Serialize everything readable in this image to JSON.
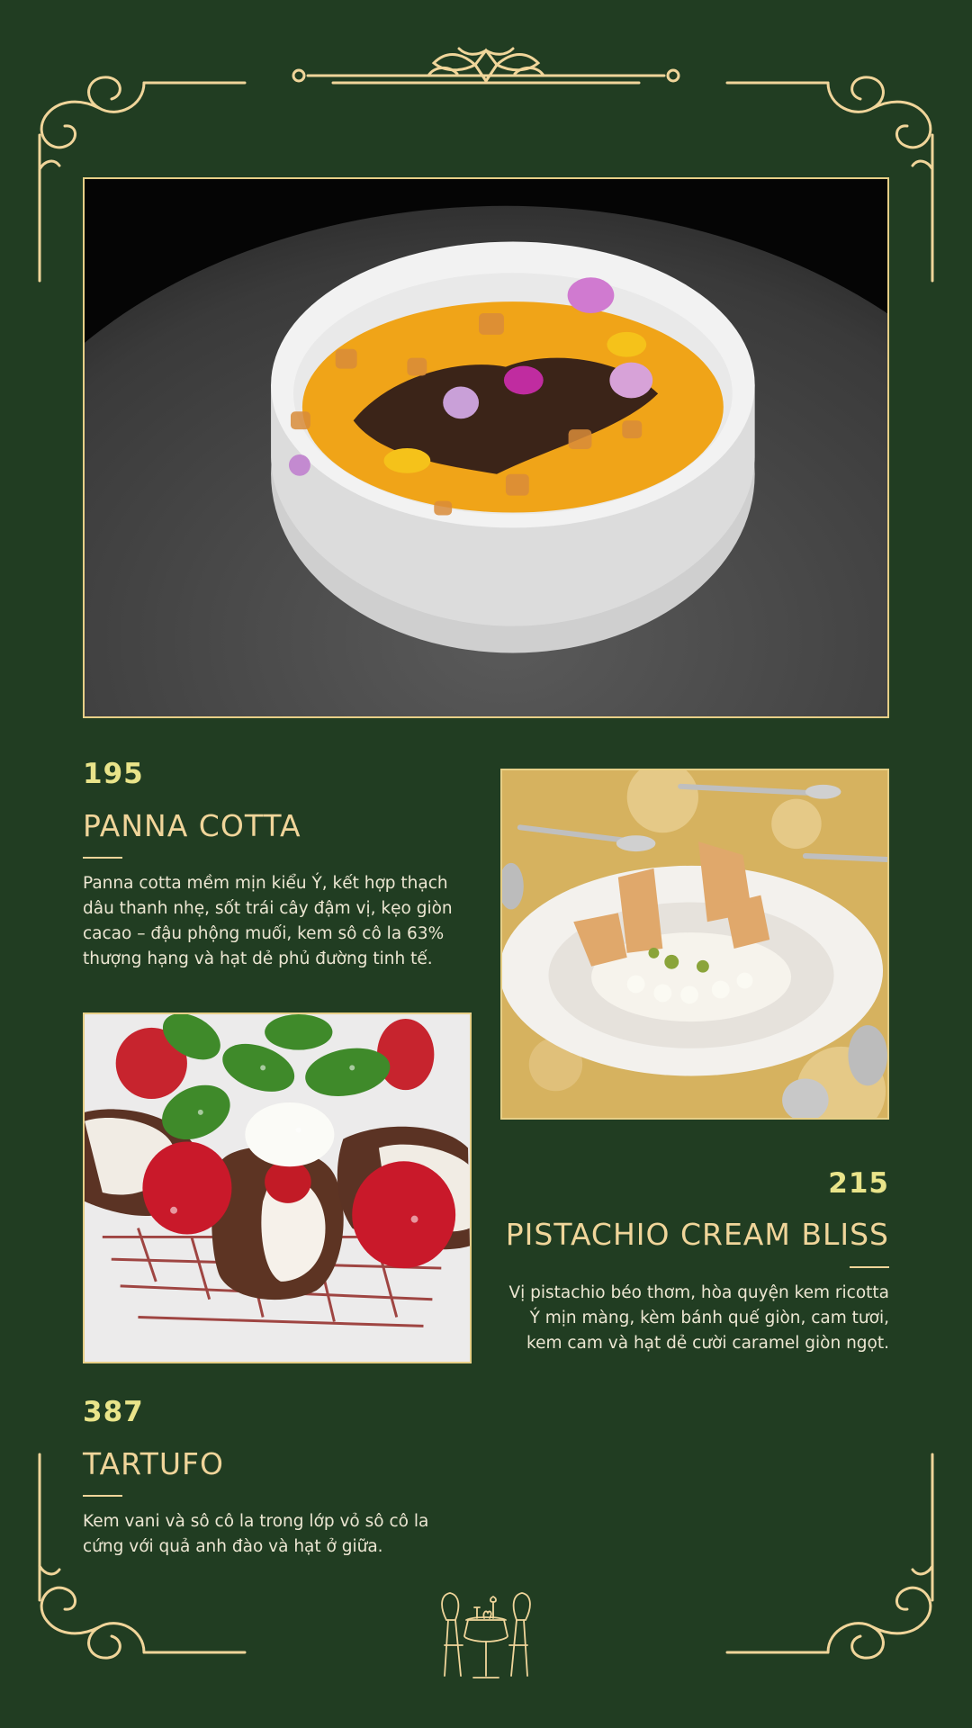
{
  "colors": {
    "background": "#213d22",
    "gold": "#f0d59a",
    "price": "#e9e48a",
    "text": "#ece6d2"
  },
  "ornaments": [
    "corner-scroll-top-left",
    "corner-scroll-top-right",
    "corner-scroll-bottom-left",
    "corner-scroll-bottom-right",
    "top-center-flourish",
    "bottom-dining-table-icon"
  ],
  "items": [
    {
      "price": "195",
      "name": "PANNA COTTA",
      "description": "Panna cotta mềm mịn kiểu Ý, kết hợp thạch dâu thanh nhẹ, sốt trái cây đậm vị, kẹo giòn cacao – đậu phộng muối, kem sô cô la 63% thượng hạng và hạt dẻ phủ đường tinh tế."
    },
    {
      "price": "215",
      "name": "PISTACHIO CREAM BLISS",
      "description": "Vị pistachio béo thơm, hòa quyện kem ricotta Ý mịn màng, kèm bánh quế giòn, cam tươi, kem cam và hạt dẻ cười caramel giòn ngọt."
    },
    {
      "price": "387",
      "name": "TARTUFO",
      "description": "Kem vani và sô cô la trong lớp vỏ sô cô la cứng với quả anh đào và hạt ở giữa."
    }
  ]
}
